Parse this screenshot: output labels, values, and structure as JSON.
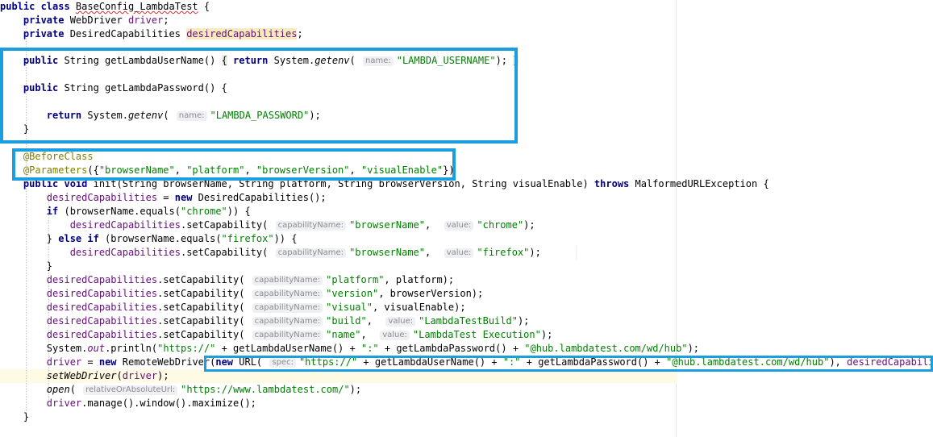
{
  "lines": [
    {
      "id": "line-1",
      "tokens": [
        {
          "t": "public class ",
          "c": "kw"
        },
        {
          "t": "BaseConfig_LambdaTest",
          "c": "typo"
        },
        {
          "t": " {"
        }
      ]
    },
    {
      "id": "line-2",
      "tokens": [
        {
          "t": "    private ",
          "c": "kw"
        },
        {
          "t": "WebDriver "
        },
        {
          "t": "driver",
          "c": "fld"
        },
        {
          "t": ";"
        }
      ]
    },
    {
      "id": "line-3",
      "tokens": [
        {
          "t": "    private ",
          "c": "kw"
        },
        {
          "t": "DesiredCapabilities "
        },
        {
          "t": "desiredCapabilities",
          "c": "fld warn"
        },
        {
          "t": ";"
        }
      ]
    },
    {
      "id": "line-4",
      "tokens": [
        {
          "t": "    public ",
          "c": "kw"
        },
        {
          "t": "String getLambdaUserName() "
        },
        {
          "t": "{",
          "c": "brace-hl"
        },
        {
          "t": " "
        },
        {
          "t": "return ",
          "c": "kw"
        },
        {
          "t": "System."
        },
        {
          "t": "getenv",
          "c": "it"
        },
        {
          "t": "( "
        },
        {
          "t": "name:",
          "c": "hint"
        },
        {
          "t": "\"LAMBDA_USERNAME\"",
          "c": "str"
        },
        {
          "t": "); "
        },
        {
          "t": "}",
          "c": "brace-hl"
        }
      ]
    },
    {
      "id": "line-5",
      "tokens": [
        {
          "t": "    public ",
          "c": "kw"
        },
        {
          "t": "String getLambdaPassword() {"
        }
      ]
    },
    {
      "id": "line-6",
      "tokens": [
        {
          "t": "        return ",
          "c": "kw"
        },
        {
          "t": "System."
        },
        {
          "t": "getenv",
          "c": "it"
        },
        {
          "t": "( "
        },
        {
          "t": "name:",
          "c": "hint"
        },
        {
          "t": "\"LAMBDA_PASSWORD\"",
          "c": "str"
        },
        {
          "t": ");"
        }
      ]
    },
    {
      "id": "line-7",
      "tokens": [
        {
          "t": "    }"
        }
      ]
    },
    {
      "id": "line-8",
      "tokens": [
        {
          "t": "    @BeforeClass",
          "c": "ann"
        }
      ]
    },
    {
      "id": "line-9",
      "tokens": [
        {
          "t": "    @Parameters",
          "c": "ann"
        },
        {
          "t": "({"
        },
        {
          "t": "\"browserName\"",
          "c": "str"
        },
        {
          "t": ", "
        },
        {
          "t": "\"platform\"",
          "c": "str"
        },
        {
          "t": ", "
        },
        {
          "t": "\"browserVersion\"",
          "c": "str"
        },
        {
          "t": ", "
        },
        {
          "t": "\"visualEnable\"",
          "c": "str"
        },
        {
          "t": "})"
        }
      ]
    },
    {
      "id": "line-10",
      "tokens": [
        {
          "t": "    public void ",
          "c": "kw"
        },
        {
          "t": "init(String browserName, String platform, String browserVersion, String visualEnable) "
        },
        {
          "t": "throws ",
          "c": "kw"
        },
        {
          "t": "MalformedURLException {"
        }
      ]
    },
    {
      "id": "line-11",
      "tokens": [
        {
          "t": "        "
        },
        {
          "t": "desiredCapabilities",
          "c": "fld"
        },
        {
          "t": " = "
        },
        {
          "t": "new ",
          "c": "kw"
        },
        {
          "t": "DesiredCapabilities();"
        }
      ]
    },
    {
      "id": "line-12",
      "tokens": [
        {
          "t": "        "
        },
        {
          "t": "if ",
          "c": "kw"
        },
        {
          "t": "(browserName.equals("
        },
        {
          "t": "\"chrome\"",
          "c": "str"
        },
        {
          "t": ")) {"
        }
      ]
    },
    {
      "id": "line-13",
      "tokens": [
        {
          "t": "            "
        },
        {
          "t": "desiredCapabilities",
          "c": "fld"
        },
        {
          "t": ".setCapability( "
        },
        {
          "t": "capabilityName:",
          "c": "hint"
        },
        {
          "t": "\"browserName\"",
          "c": "str"
        },
        {
          "t": ",  "
        },
        {
          "t": "value:",
          "c": "hint"
        },
        {
          "t": "\"chrome\"",
          "c": "str"
        },
        {
          "t": ");"
        }
      ]
    },
    {
      "id": "line-14",
      "tokens": [
        {
          "t": "        } "
        },
        {
          "t": "else if ",
          "c": "kw"
        },
        {
          "t": "(browserName.equals("
        },
        {
          "t": "\"firefox\"",
          "c": "str"
        },
        {
          "t": ")) {"
        }
      ]
    },
    {
      "id": "line-15",
      "tokens": [
        {
          "t": "            "
        },
        {
          "t": "desiredCapabilities",
          "c": "fld"
        },
        {
          "t": ".setCapability( "
        },
        {
          "t": "capabilityName:",
          "c": "hint"
        },
        {
          "t": "\"browserName\"",
          "c": "str"
        },
        {
          "t": ",  "
        },
        {
          "t": "value:",
          "c": "hint"
        },
        {
          "t": "\"firefox\"",
          "c": "str"
        },
        {
          "t": ");"
        }
      ]
    },
    {
      "id": "line-16",
      "tokens": [
        {
          "t": "        }"
        }
      ]
    },
    {
      "id": "line-17",
      "tokens": [
        {
          "t": "        "
        },
        {
          "t": "desiredCapabilities",
          "c": "fld"
        },
        {
          "t": ".setCapability( "
        },
        {
          "t": "capabilityName:",
          "c": "hint"
        },
        {
          "t": "\"platform\"",
          "c": "str"
        },
        {
          "t": ", platform);"
        }
      ]
    },
    {
      "id": "line-18",
      "tokens": [
        {
          "t": "        "
        },
        {
          "t": "desiredCapabilities",
          "c": "fld"
        },
        {
          "t": ".setCapability( "
        },
        {
          "t": "capabilityName:",
          "c": "hint"
        },
        {
          "t": "\"version\"",
          "c": "str"
        },
        {
          "t": ", browserVersion);"
        }
      ]
    },
    {
      "id": "line-19",
      "tokens": [
        {
          "t": "        "
        },
        {
          "t": "desiredCapabilities",
          "c": "fld"
        },
        {
          "t": ".setCapability( "
        },
        {
          "t": "capabilityName:",
          "c": "hint"
        },
        {
          "t": "\"visual\"",
          "c": "str"
        },
        {
          "t": ", visualEnable);"
        }
      ]
    },
    {
      "id": "line-20",
      "tokens": [
        {
          "t": "        "
        },
        {
          "t": "desiredCapabilities",
          "c": "fld"
        },
        {
          "t": ".setCapability( "
        },
        {
          "t": "capabilityName:",
          "c": "hint"
        },
        {
          "t": "\"build\"",
          "c": "str"
        },
        {
          "t": ",  "
        },
        {
          "t": "value:",
          "c": "hint"
        },
        {
          "t": "\"LambdaTestBuild\"",
          "c": "str"
        },
        {
          "t": ");"
        }
      ]
    },
    {
      "id": "line-21",
      "tokens": [
        {
          "t": "        "
        },
        {
          "t": "desiredCapabilities",
          "c": "fld"
        },
        {
          "t": ".setCapability( "
        },
        {
          "t": "capabilityName:",
          "c": "hint"
        },
        {
          "t": "\"name\"",
          "c": "str"
        },
        {
          "t": ",  "
        },
        {
          "t": "value:",
          "c": "hint"
        },
        {
          "t": "\"LambdaTest Execution\"",
          "c": "str"
        },
        {
          "t": ");"
        }
      ]
    },
    {
      "id": "line-22",
      "tokens": [
        {
          "t": "        System."
        },
        {
          "t": "out",
          "c": "fld it"
        },
        {
          "t": ".println("
        },
        {
          "t": "\"https://\"",
          "c": "str"
        },
        {
          "t": " + getLambdaUserName() + "
        },
        {
          "t": "\":\"",
          "c": "str"
        },
        {
          "t": " + getLambdaPassword() + "
        },
        {
          "t": "\"@hub.lambdatest.com/wd/hub\"",
          "c": "str"
        },
        {
          "t": ");"
        }
      ]
    },
    {
      "id": "line-23",
      "tokens": [
        {
          "t": "        "
        },
        {
          "t": "driver",
          "c": "fld"
        },
        {
          "t": " = "
        },
        {
          "t": "new ",
          "c": "kw"
        },
        {
          "t": "RemoteWebDriver("
        },
        {
          "t": "new ",
          "c": "kw"
        },
        {
          "t": "URL( "
        },
        {
          "t": "spec:",
          "c": "hint"
        },
        {
          "t": "\"https://\"",
          "c": "str"
        },
        {
          "t": " + getLambdaUserName() + "
        },
        {
          "t": "\":\"",
          "c": "str"
        },
        {
          "t": " + getLambdaPassword() + "
        },
        {
          "t": "\"@hub.lambdatest.com/wd/hub\"",
          "c": "str"
        },
        {
          "t": "), "
        },
        {
          "t": "desiredCapabilities",
          "c": "fld"
        },
        {
          "t": ");"
        }
      ]
    },
    {
      "id": "line-24",
      "tokens": [
        {
          "t": "        "
        },
        {
          "t": "setWebDriver",
          "c": "it"
        },
        {
          "t": "("
        },
        {
          "t": "driver",
          "c": "fld"
        },
        {
          "t": ");"
        }
      ]
    },
    {
      "id": "line-25",
      "tokens": [
        {
          "t": "        "
        },
        {
          "t": "open",
          "c": "it"
        },
        {
          "t": "( "
        },
        {
          "t": "relativeOrAbsoluteUrl:",
          "c": "hint"
        },
        {
          "t": "\"https://www.lambdatest.com/\"",
          "c": "str"
        },
        {
          "t": ");"
        }
      ]
    },
    {
      "id": "line-26",
      "tokens": [
        {
          "t": "        "
        },
        {
          "t": "driver",
          "c": "fld"
        },
        {
          "t": ".manage().window().maximize();"
        }
      ]
    },
    {
      "id": "line-27",
      "tokens": [
        {
          "t": "    }"
        }
      ]
    }
  ]
}
